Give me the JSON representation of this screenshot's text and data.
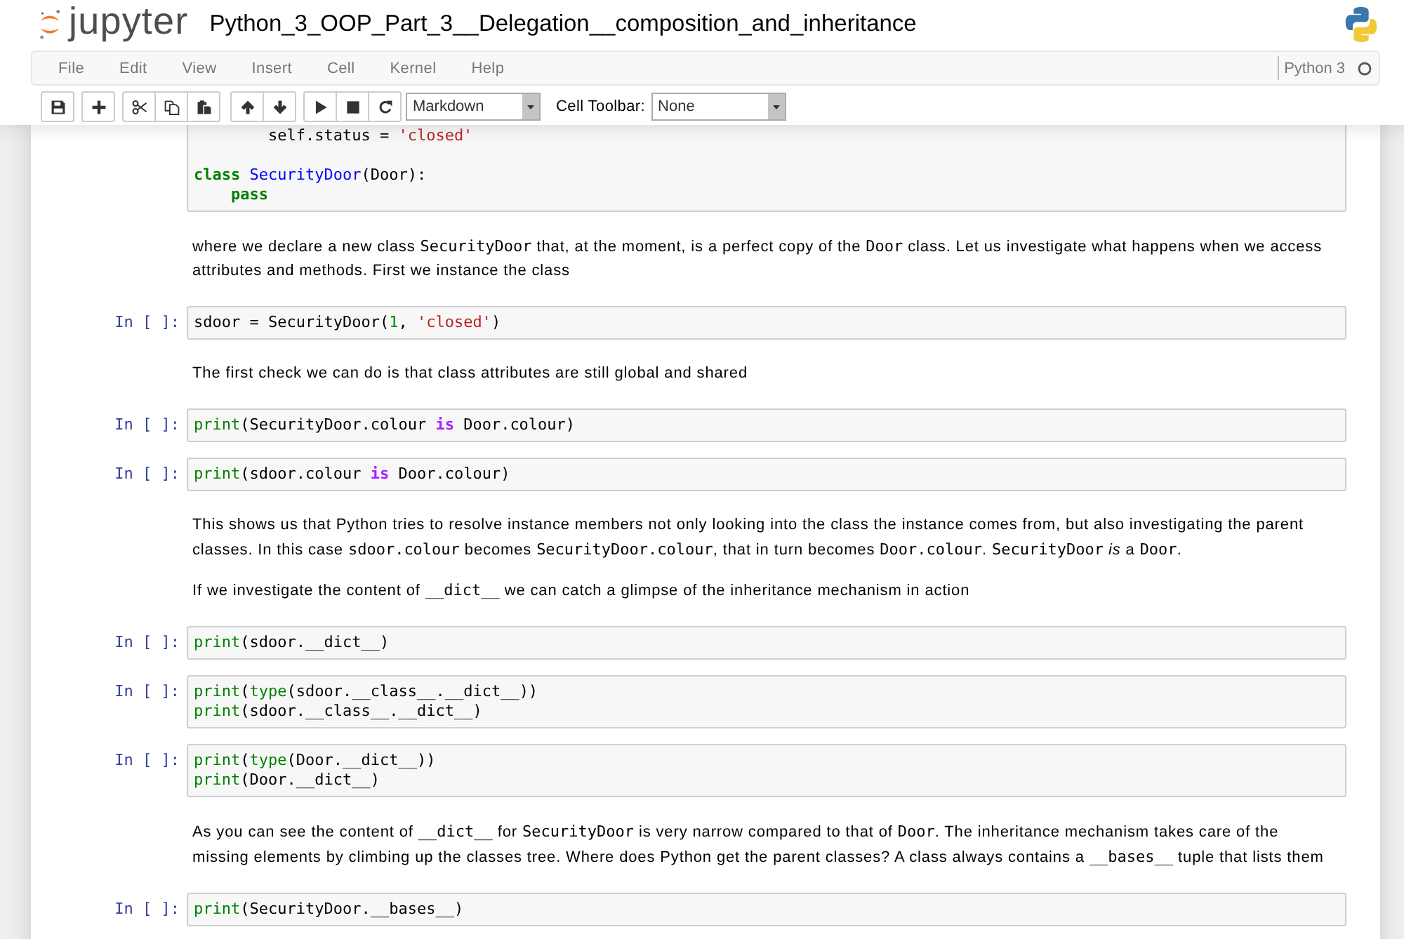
{
  "header": {
    "logo_text": "jupyter",
    "notebook_name": "Python_3_OOP_Part_3__Delegation__composition_and_inheritance"
  },
  "menu": [
    "File",
    "Edit",
    "View",
    "Insert",
    "Cell",
    "Kernel",
    "Help"
  ],
  "kernel": {
    "name": "Python 3",
    "busy": false
  },
  "toolbar": {
    "cell_type": "Markdown",
    "cell_toolbar_label": "Cell Toolbar:",
    "cell_toolbar": "None"
  },
  "cells": [
    {
      "kind": "code",
      "tokens": [
        {
          "kind": "plain",
          "text": "        self.status = "
        },
        {
          "kind": "string",
          "text": "'closed'\n\n"
        },
        {
          "kind": "keyword",
          "text": "class"
        },
        {
          "kind": "def",
          "text": " SecurityDoor"
        },
        {
          "kind": "plain",
          "text": "(Door):\n    "
        },
        {
          "kind": "keyword",
          "text": "pass"
        }
      ]
    },
    {
      "kind": "markdown",
      "paragraphs": [
        {
          "lines": [
            [
              {
                "kind": "text",
                "text": "where we declare a new class "
              },
              {
                "kind": "code",
                "text": "SecurityDoor"
              },
              {
                "kind": "text",
                "text": " that, at the moment, is a perfect copy of the "
              },
              {
                "kind": "code",
                "text": "Door"
              },
              {
                "kind": "text",
                "text": " class. Let us investigate what happens when we access"
              }
            ],
            [
              {
                "kind": "text",
                "text": "attributes and methods. First we instance the class"
              }
            ]
          ]
        }
      ]
    },
    {
      "kind": "code",
      "prompt": "In [ ]:",
      "tokens": [
        {
          "kind": "plain",
          "text": "sdoor = SecurityDoor("
        },
        {
          "kind": "number",
          "text": "1"
        },
        {
          "kind": "plain",
          "text": ", "
        },
        {
          "kind": "string",
          "text": "'closed'"
        },
        {
          "kind": "plain",
          "text": ")"
        }
      ]
    },
    {
      "kind": "markdown",
      "paragraphs": [
        {
          "lines": [
            [
              {
                "kind": "text",
                "text": "The first check we can do is that class attributes are still global and shared"
              }
            ]
          ]
        }
      ]
    },
    {
      "kind": "code",
      "prompt": "In [ ]:",
      "tokens": [
        {
          "kind": "builtin",
          "text": "print"
        },
        {
          "kind": "plain",
          "text": "(SecurityDoor.colour "
        },
        {
          "kind": "operator",
          "text": "is"
        },
        {
          "kind": "plain",
          "text": " Door.colour)"
        }
      ]
    },
    {
      "kind": "code",
      "prompt": "In [ ]:",
      "tokens": [
        {
          "kind": "builtin",
          "text": "print"
        },
        {
          "kind": "plain",
          "text": "(sdoor.colour "
        },
        {
          "kind": "operator",
          "text": "is"
        },
        {
          "kind": "plain",
          "text": " Door.colour)"
        }
      ]
    },
    {
      "kind": "markdown",
      "paragraphs": [
        {
          "lines": [
            [
              {
                "kind": "text",
                "text": "This shows us that Python tries to resolve instance members not only looking into the class the instance comes from, but also investigating the parent"
              }
            ],
            [
              {
                "kind": "text",
                "text": "classes. In this case "
              },
              {
                "kind": "code",
                "text": "sdoor.colour"
              },
              {
                "kind": "text",
                "text": " becomes "
              },
              {
                "kind": "code",
                "text": "SecurityDoor.colour"
              },
              {
                "kind": "text",
                "text": ", that in turn becomes "
              },
              {
                "kind": "code",
                "text": "Door.colour"
              },
              {
                "kind": "text",
                "text": ". "
              },
              {
                "kind": "code",
                "text": "SecurityDoor"
              },
              {
                "kind": "text",
                "text": " *is* a "
              },
              {
                "kind": "code",
                "text": "Door"
              },
              {
                "kind": "text",
                "text": "."
              }
            ]
          ]
        },
        {
          "lines": [
            [
              {
                "kind": "text",
                "text": "If we investigate the content of "
              },
              {
                "kind": "code",
                "text": "__dict__"
              },
              {
                "kind": "text",
                "text": " we can catch a glimpse of the inheritance mechanism in action"
              }
            ]
          ]
        }
      ]
    },
    {
      "kind": "code",
      "prompt": "In [ ]:",
      "tokens": [
        {
          "kind": "builtin",
          "text": "print"
        },
        {
          "kind": "plain",
          "text": "(sdoor.__dict__)"
        }
      ]
    },
    {
      "kind": "code",
      "prompt": "In [ ]:",
      "tokens": [
        {
          "kind": "builtin",
          "text": "print"
        },
        {
          "kind": "plain",
          "text": "("
        },
        {
          "kind": "builtin",
          "text": "type"
        },
        {
          "kind": "plain",
          "text": "(sdoor.__class__.__dict__))\n"
        },
        {
          "kind": "builtin",
          "text": "print"
        },
        {
          "kind": "plain",
          "text": "(sdoor.__class__.__dict__)"
        }
      ]
    },
    {
      "kind": "code",
      "prompt": "In [ ]:",
      "tokens": [
        {
          "kind": "builtin",
          "text": "print"
        },
        {
          "kind": "plain",
          "text": "("
        },
        {
          "kind": "builtin",
          "text": "type"
        },
        {
          "kind": "plain",
          "text": "(Door.__dict__))\n"
        },
        {
          "kind": "builtin",
          "text": "print"
        },
        {
          "kind": "plain",
          "text": "(Door.__dict__)"
        }
      ]
    },
    {
      "kind": "markdown",
      "paragraphs": [
        {
          "lines": [
            [
              {
                "kind": "text",
                "text": "As you can see the content of "
              },
              {
                "kind": "code",
                "text": "__dict__"
              },
              {
                "kind": "text",
                "text": " for "
              },
              {
                "kind": "code",
                "text": "SecurityDoor"
              },
              {
                "kind": "text",
                "text": " is very narrow compared to that of "
              },
              {
                "kind": "code",
                "text": "Door"
              },
              {
                "kind": "text",
                "text": ". The inheritance mechanism takes care of the"
              }
            ],
            [
              {
                "kind": "text",
                "text": "missing elements by climbing up the classes tree. Where does Python get the parent classes? A class always contains a "
              },
              {
                "kind": "code",
                "text": "__bases__"
              },
              {
                "kind": "text",
                "text": " tuple that lists them"
              }
            ]
          ]
        }
      ]
    },
    {
      "kind": "code",
      "prompt": "In [ ]:",
      "tokens": [
        {
          "kind": "builtin",
          "text": "print"
        },
        {
          "kind": "plain",
          "text": "(SecurityDoor.__bases__)"
        }
      ]
    }
  ]
}
